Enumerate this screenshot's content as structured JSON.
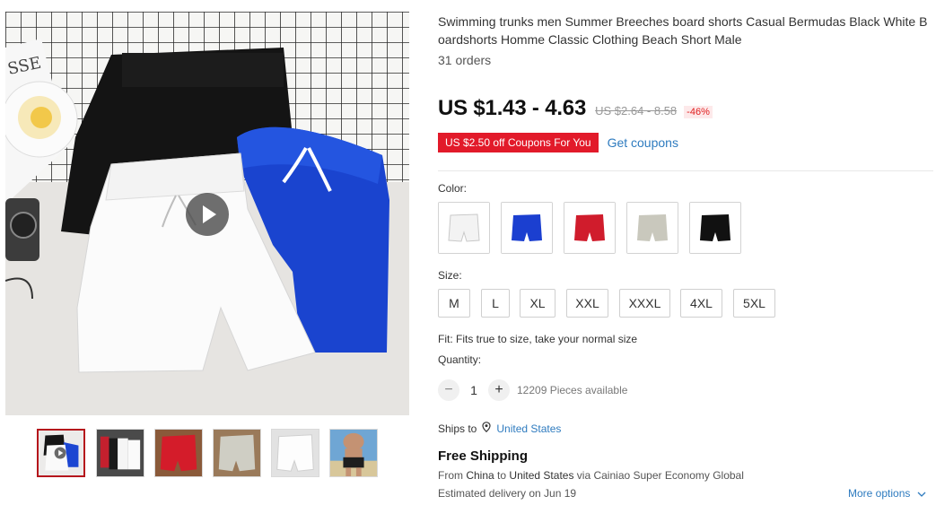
{
  "product": {
    "title": "Swimming trunks men Summer Breeches board shorts Casual Bermudas Black White Boardshorts Homme Classic Clothing Beach Short Male",
    "orders": "31 orders"
  },
  "gallery": {
    "main_image": "shorts-flatlay-photo",
    "play_icon": "play-icon",
    "thumbnails": [
      {
        "name": "thumbnail-1",
        "label": "black-white-blue shorts video"
      },
      {
        "name": "thumbnail-2",
        "label": "multi-color shorts"
      },
      {
        "name": "thumbnail-3",
        "label": "red shorts"
      },
      {
        "name": "thumbnail-4",
        "label": "gray shorts"
      },
      {
        "name": "thumbnail-5",
        "label": "white shorts"
      },
      {
        "name": "thumbnail-6",
        "label": "model wearing shorts"
      }
    ]
  },
  "pricing": {
    "price": "US $1.43 - 4.63",
    "old_price": "US $2.64 - 8.58",
    "discount": "-46%"
  },
  "coupon": {
    "badge": "US $2.50 off Coupons For You",
    "link": "Get coupons"
  },
  "variants": {
    "color_label": "Color:",
    "colors": [
      {
        "name": "white",
        "hex": "#f4f4f4"
      },
      {
        "name": "blue",
        "hex": "#1b3fd0"
      },
      {
        "name": "red",
        "hex": "#d01c2c"
      },
      {
        "name": "gray",
        "hex": "#c9c8bd"
      },
      {
        "name": "black",
        "hex": "#111111"
      }
    ],
    "size_label": "Size:",
    "sizes": [
      "M",
      "L",
      "XL",
      "XXL",
      "XXXL",
      "4XL",
      "5XL"
    ],
    "fit": "Fit: Fits true to size, take your normal size"
  },
  "quantity": {
    "label": "Quantity:",
    "minus": "−",
    "value": "1",
    "plus": "+",
    "available": "12209 Pieces available"
  },
  "shipping": {
    "ships_to_label": "Ships to",
    "country": "United States",
    "free_shipping": "Free Shipping",
    "route_from": "From",
    "origin": "China",
    "route_to": "to",
    "destination": "United States",
    "route_via": "via Cainiao Super Economy Global",
    "delivery": "Estimated delivery on Jun 19",
    "more_options": "More options"
  },
  "colors": {
    "accent_red": "#e21a2a",
    "link_blue": "#2e7bbf",
    "active_thumb_border": "#b5161c"
  }
}
